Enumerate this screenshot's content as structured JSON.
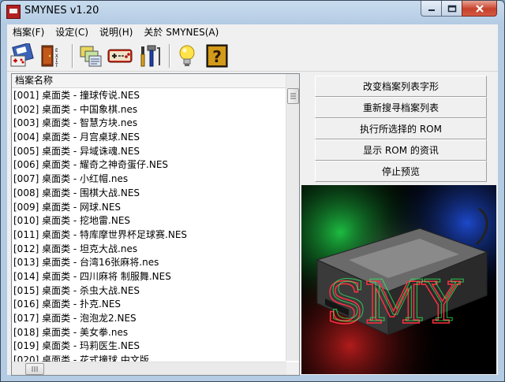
{
  "window": {
    "title": "SMYNES v1.20"
  },
  "menu": [
    "档案(F)",
    "设定(C)",
    "说明(H)",
    "关於 SMYNES(A)"
  ],
  "toolbar": {
    "buttons": [
      "open-rom-icon",
      "exit-icon",
      "file-list-icon",
      "gamepad-icon",
      "tools-icon",
      "bulb-icon",
      "help-icon"
    ],
    "exit_label": "EXIT"
  },
  "list": {
    "header": "档案名称",
    "rows": [
      "[001]  桌面类 - 撞球传说.NES",
      "[002]  桌面类 - 中国象棋.nes",
      "[003]  桌面类 - 智慧方块.nes",
      "[004]  桌面类 - 月宫桌球.NES",
      "[005]  桌面类 - 异域诛魂.NES",
      "[006]  桌面类 - 耀奇之神奇蛋仔.NES",
      "[007]  桌面类 - 小红帽.nes",
      "[008]  桌面类 - 围棋大战.NES",
      "[009]  桌面类 - 网球.NES",
      "[010]  桌面类 - 挖地雷.NES",
      "[011]  桌面类 - 特库摩世界杯足球赛.NES",
      "[012]  桌面类 - 坦克大战.nes",
      "[013]  桌面类 - 台湾16张麻将.nes",
      "[014]  桌面类 - 四川麻将 制服舞.NES",
      "[015]  桌面类 - 杀虫大战.NES",
      "[016]  桌面类 - 扑克.NES",
      "[017]  桌面类 - 泡泡龙2.NES",
      "[018]  桌面类 - 美女拳.nes",
      "[019]  桌面类 - 玛莉医生.NES",
      "[020]  桌面类 - 花式撞球 中文版"
    ]
  },
  "actions": [
    "改变档案列表字形",
    "重新搜寻档案列表",
    "执行所选择的 ROM",
    "显示 ROM 的资讯",
    "停止预览"
  ],
  "preview": {
    "logo_text": "SMY"
  }
}
